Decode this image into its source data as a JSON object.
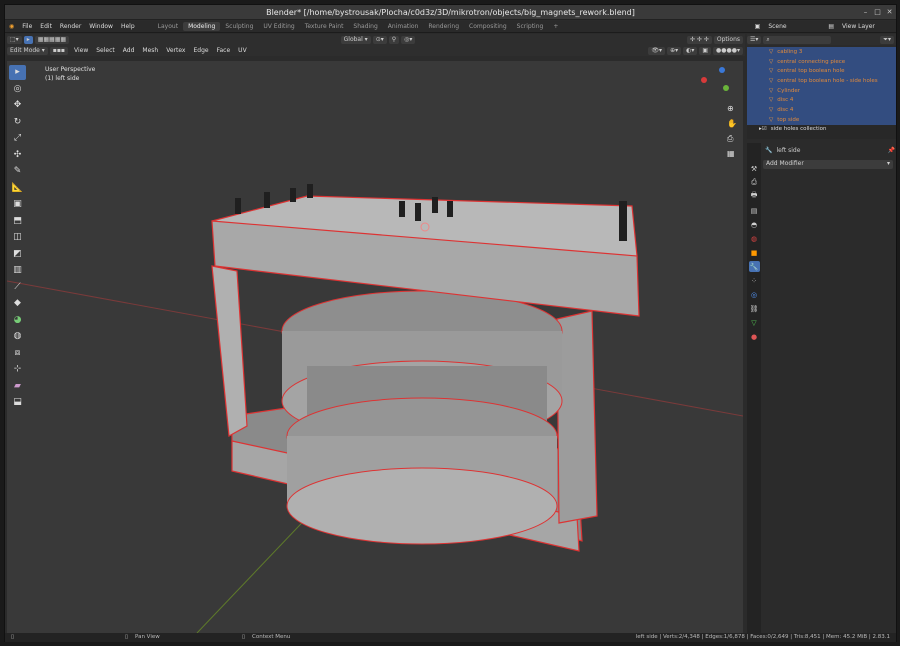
{
  "window": {
    "title": "Blender* [/home/bystrousak/Plocha/c0d3z/3D/mikrotron/objects/big_magnets_rework.blend]"
  },
  "menu": [
    "File",
    "Edit",
    "Render",
    "Window",
    "Help"
  ],
  "workspaces": [
    "Layout",
    "Modeling",
    "Sculpting",
    "UV Editing",
    "Texture Paint",
    "Shading",
    "Animation",
    "Rendering",
    "Compositing",
    "Scripting"
  ],
  "active_workspace": "Modeling",
  "scene": {
    "label": "Scene"
  },
  "view_layer": {
    "label": "View Layer"
  },
  "editor_header": {
    "mode": "Edit Mode",
    "items": [
      "View",
      "Select",
      "Add",
      "Mesh",
      "Vertex",
      "Edge",
      "Face",
      "UV"
    ],
    "transform": "Global",
    "options": "Options"
  },
  "viewport": {
    "perspective": "User Perspective",
    "object": "(1) left side"
  },
  "outliner": {
    "rows": [
      {
        "label": "cabling 3",
        "sel": true
      },
      {
        "label": "central connecting piece",
        "sel": true
      },
      {
        "label": "central top boolean hole",
        "sel": true
      },
      {
        "label": "central top boolean hole - side holes",
        "sel": true
      },
      {
        "label": "Cylinder",
        "sel": true
      },
      {
        "label": "disc 4",
        "sel": true
      },
      {
        "label": "disc 4",
        "sel": true
      },
      {
        "label": "top side",
        "sel": true
      },
      {
        "label": "side holes collection",
        "sel": false
      }
    ]
  },
  "properties": {
    "object_name": "left side",
    "add_modifier": "Add Modifier"
  },
  "statusbar": {
    "pan": "Pan View",
    "context": "Context Menu",
    "stats": "left side | Verts:2/4,348 | Edges:1/6,878 | Faces:0/2,649 | Tris:8,451 | Mem: 45.2 MiB | 2.83.1"
  },
  "colors": {
    "accent": "#4772b3",
    "selection": "#e03030",
    "outliner_select": "#334d80"
  }
}
